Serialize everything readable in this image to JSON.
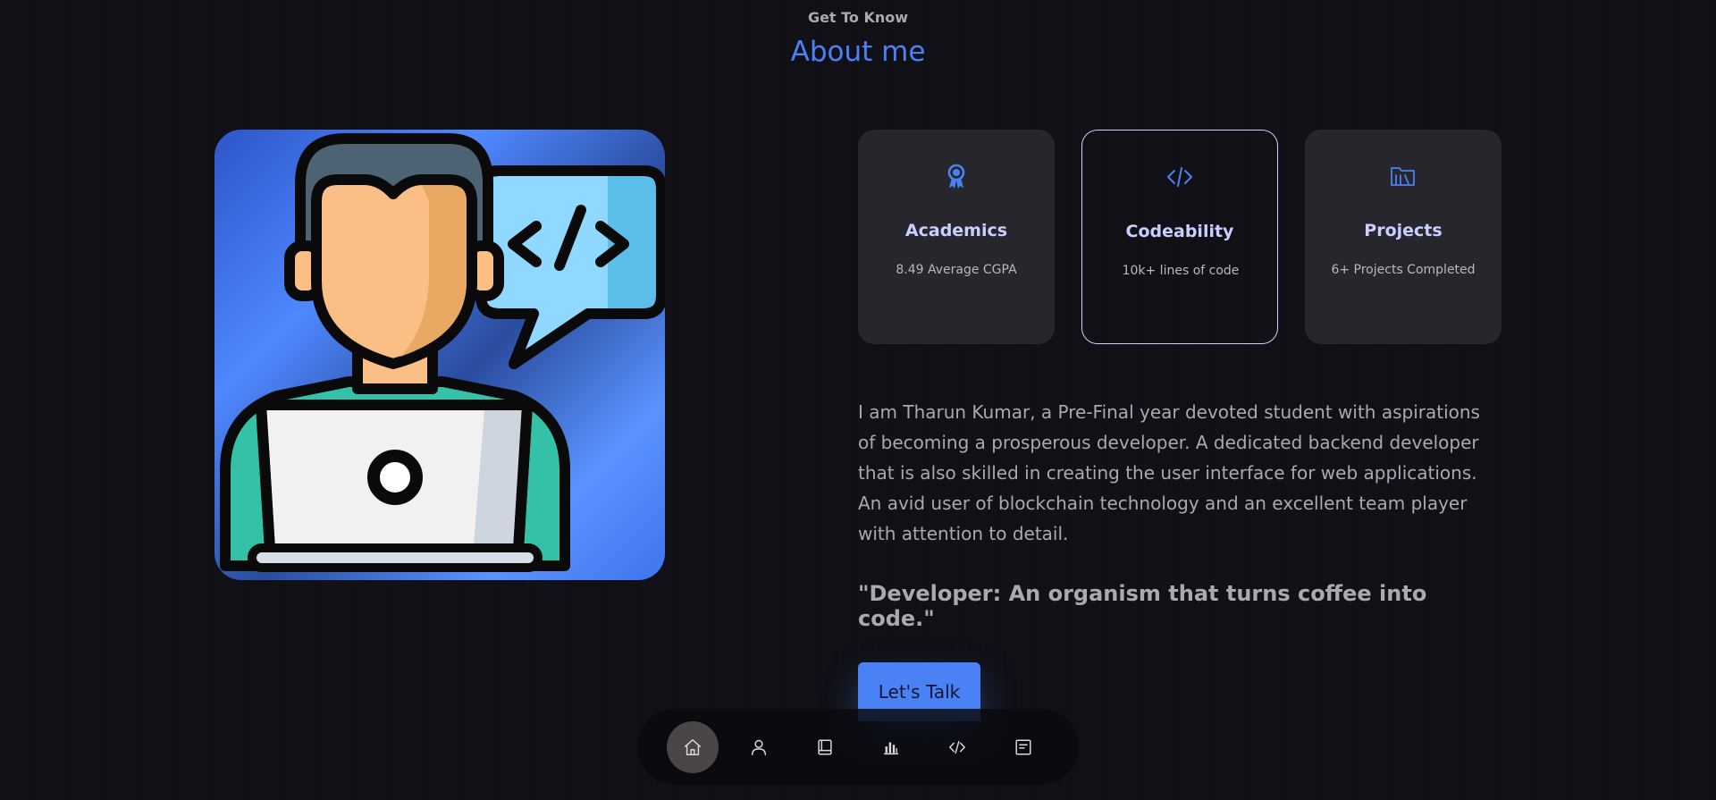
{
  "header": {
    "eyebrow": "Get To Know",
    "title": "About me"
  },
  "stats_cards": [
    {
      "icon": "award-icon",
      "title": "Academics",
      "subtitle": "8.49 Average CGPA"
    },
    {
      "icon": "code-icon",
      "title": "Codeability",
      "subtitle": "10k+ lines of code"
    },
    {
      "icon": "folder-library-icon",
      "title": "Projects",
      "subtitle": "6+ Projects Completed"
    }
  ],
  "bio": "I am Tharun Kumar, a Pre-Final year devoted student with aspirations of becoming a prosperous developer. A dedicated backend developer that is also skilled in creating the user interface for web applications. An avid user of blockchain technology and an excellent team player with attention to detail.",
  "quote": "\"Developer: An organism that turns coffee into code.\"",
  "cta": {
    "label": "Let's Talk"
  },
  "nav": {
    "items": [
      "home-icon",
      "user-icon",
      "book-icon",
      "bar-chart-icon",
      "code-icon",
      "message-icon"
    ],
    "active_index": 0
  },
  "colors": {
    "background": "#101016",
    "accent": "#4a82f5",
    "card": "#27262c",
    "card_title": "#c8d0ff",
    "text": "#a9a9b0",
    "active_nav": "#4a4546"
  }
}
